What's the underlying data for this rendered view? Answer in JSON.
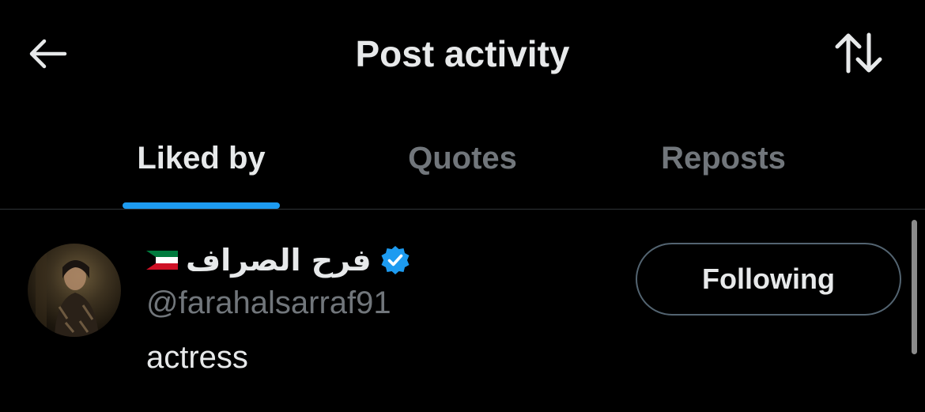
{
  "header": {
    "title": "Post activity",
    "back_icon": "arrow-left-icon",
    "sort_icon": "sort-arrows-icon"
  },
  "tabs": [
    {
      "label": "Liked by",
      "active": true
    },
    {
      "label": "Quotes",
      "active": false
    },
    {
      "label": "Reposts",
      "active": false
    }
  ],
  "users": [
    {
      "display_name": "فرح الصراف",
      "flag": "kuwait-flag",
      "verified": true,
      "handle": "@farahalsarraf91",
      "bio": "actress",
      "follow_label": "Following"
    }
  ],
  "colors": {
    "background": "#000000",
    "text_primary": "#e7e9ea",
    "text_secondary": "#71767b",
    "accent": "#1d9bf0",
    "divider": "#2f3336"
  }
}
